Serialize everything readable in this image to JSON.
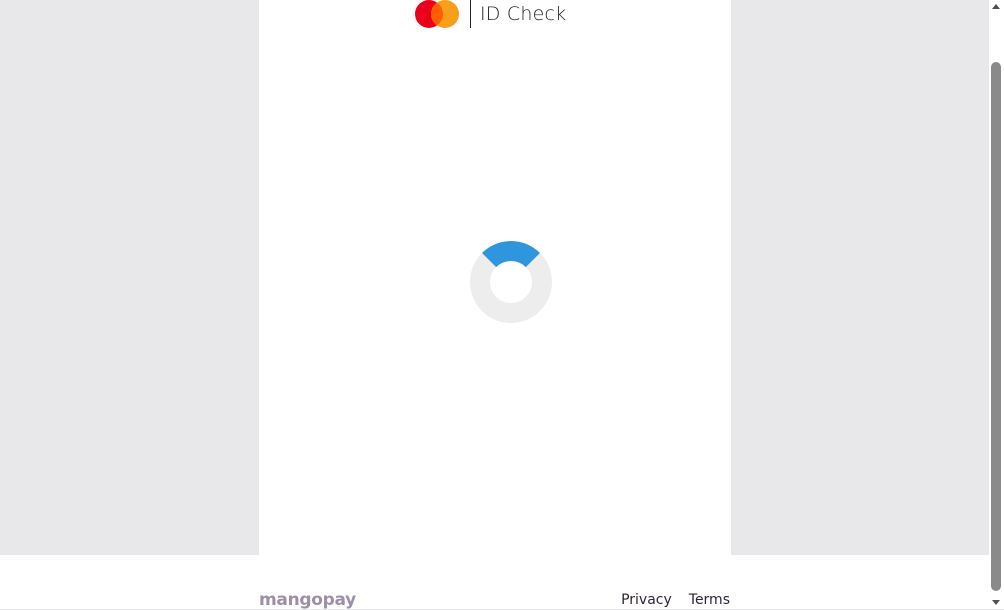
{
  "header": {
    "brand_text": "ID Check",
    "logo_name": "mastercard-logo",
    "colors": {
      "red": "#eb001b",
      "orange": "#f79e1b",
      "overlap": "#ff5f00"
    }
  },
  "loader": {
    "icon": "loading-spinner",
    "colors": {
      "track": "#ededed",
      "arc": "#2f95dc"
    }
  },
  "footer": {
    "logo_text": "mangopay",
    "links": [
      {
        "label": "Privacy"
      },
      {
        "label": "Terms"
      }
    ]
  },
  "theme": {
    "background": "#e8e7ea",
    "card": "#ffffff"
  }
}
